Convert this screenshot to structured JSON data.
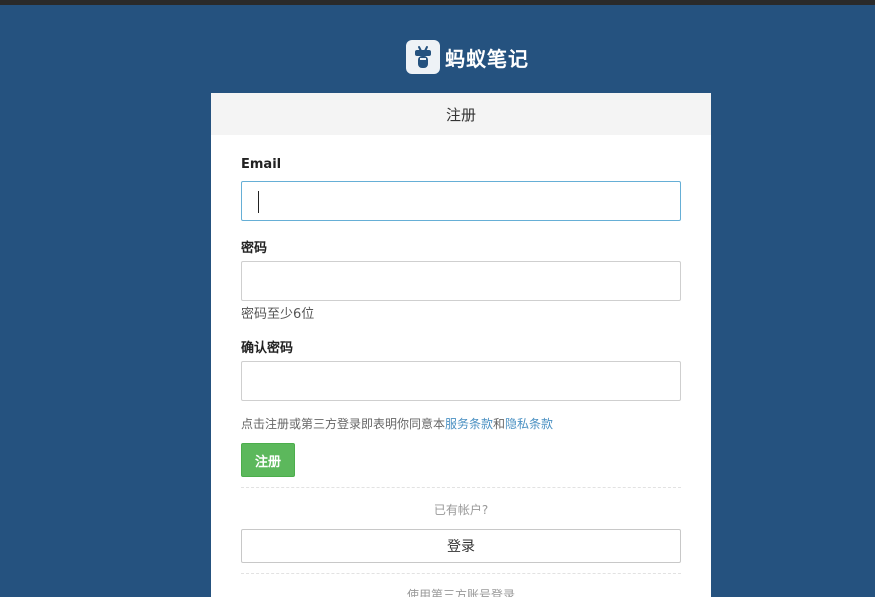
{
  "brand": {
    "name": "蚂蚁笔记",
    "icon": "ant-logo-icon"
  },
  "form": {
    "title": "注册",
    "email_label": "Email",
    "email_value": "",
    "password_label": "密码",
    "password_value": "",
    "password_hint": "密码至少6位",
    "confirm_label": "确认密码",
    "confirm_value": "",
    "terms_prefix": "点击注册或第三方登录即表明你同意本",
    "terms_service_link": "服务条款",
    "terms_and": "和",
    "terms_privacy_link": "隐私条款",
    "register_button": "注册",
    "have_account": "已有帐户?",
    "login_button": "登录",
    "third_party": "使用第三方账号登录"
  },
  "colors": {
    "background": "#25527f",
    "register_button": "#5cb85c",
    "link": "#4a90c2",
    "focus_border": "#66afd6"
  }
}
